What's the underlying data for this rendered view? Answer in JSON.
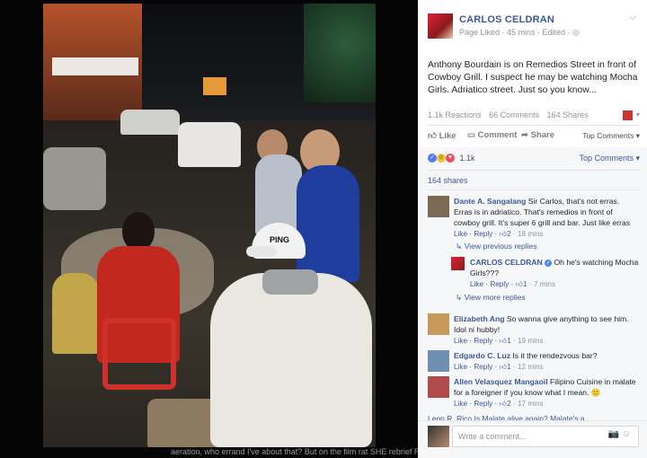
{
  "photo": {
    "cap_text": "PING",
    "caption_overlay": "aeration, who errand I've about that? But on the film rat  SHE  rebrief Raymondo dubois  Mary Kagan Geron"
  },
  "post": {
    "author": "CARLOS CELDRAN",
    "meta": "Page Liked · 45 mins · Edited · ◎",
    "text": "Anthony Bourdain is on Remedios Street in front of Cowboy Grill. I suspect he may be watching Mocha Girls. Adriatico street. Just so you know...",
    "reactions": "1.1k Reactions",
    "comments": "66 Comments",
    "shares": "164 Shares",
    "like_label": "Like",
    "comment_label": "Comment",
    "share_label": "Share",
    "top_comments": "Top Comments ▾"
  },
  "reactions_row": {
    "count": "1.1k",
    "top_comments": "Top Comments ▾",
    "shares_link": "164 shares"
  },
  "comments": [
    {
      "name": "Dante A. Sangalang",
      "text": " Sir Carlos, that's not erras. Erras is in adriatico. That's remedios in front of cowboy grill. It's super 6 grill and bar. Just like erras",
      "like": "Like",
      "reply": "Reply",
      "likes": "2",
      "time": "18 mins",
      "color": "#7b6a56"
    },
    {
      "name": "Elizabeth Ang",
      "text": " So wanna give anything to see him. Idol ni hubby!",
      "like": "Like",
      "reply": "Reply",
      "likes": "1",
      "time": "19 mins",
      "color": "#c59a5a"
    },
    {
      "name": "Edgardo C. Luz",
      "text": " Is it the rendezvous bar?",
      "like": "Like",
      "reply": "Reply",
      "likes": "1",
      "time": "12 mins",
      "color": "#6f8fb0"
    },
    {
      "name": "Allen Velasquez Mangaoil",
      "text": " Filipino Cuisine in malate for a foreigner if you know what I mean. 🙂",
      "like": "Like",
      "reply": "Reply",
      "likes": "2",
      "time": "17 mins",
      "color": "#b14a4a"
    }
  ],
  "view_previous_replies": "↳ View previous replies",
  "reply": {
    "name": "CARLOS CELDRAN",
    "text": " Oh he's watching Mocha Girls???",
    "like": "Like",
    "reply": "Reply",
    "likes": "1",
    "time": "7 mins"
  },
  "view_more_replies": "↳ View more replies",
  "peek_text": "Leon R. Rico Is Malate alive again? Malate's a",
  "write_placeholder": "Write a comment...",
  "write_icons": "📷 ☺",
  "colors": {
    "link": "#3b5998",
    "muted": "#90949c"
  }
}
